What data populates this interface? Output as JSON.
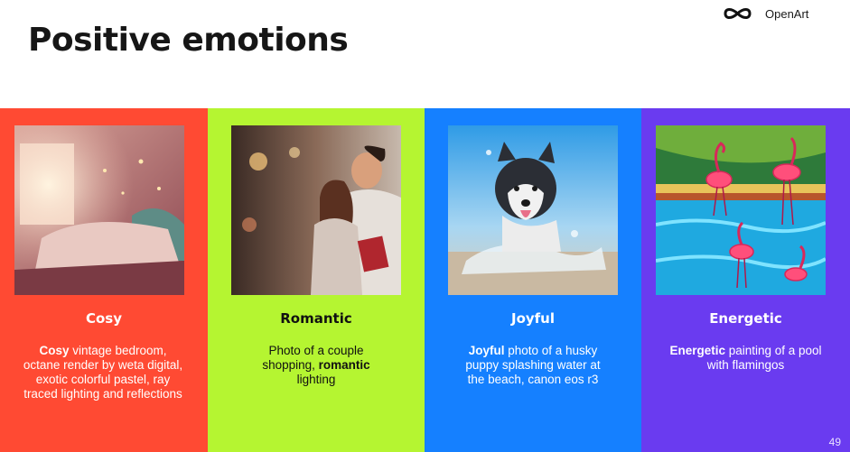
{
  "page_title": "Positive emotions",
  "brand": {
    "name": "OpenArt",
    "logo_icon": "infinity-loop-icon"
  },
  "panels": [
    {
      "title": "Cosy",
      "bg_color": "#ff4a33",
      "text_color": "#ffffff",
      "image": "cosy-bedroom-image",
      "desc_bold": "Cosy",
      "desc_after": " vintage bedroom, octane render by weta digital, exotic colorful pastel, ray traced lighting and reflections"
    },
    {
      "title": "Romantic",
      "bg_color": "#b5f531",
      "text_color": "#111111",
      "image": "couple-shopping-image",
      "desc_before": "Photo of a couple shopping, ",
      "desc_bold": "romantic",
      "desc_after": " lighting"
    },
    {
      "title": "Joyful",
      "bg_color": "#1580ff",
      "text_color": "#ffffff",
      "image": "husky-puppy-beach-image",
      "desc_bold": "Joyful",
      "desc_after": " photo of a husky puppy splashing water at the beach, canon eos r3"
    },
    {
      "title": "Energetic",
      "bg_color": "#6a3bf0",
      "text_color": "#ffffff",
      "image": "flamingo-pool-painting-image",
      "desc_bold": "Energetic",
      "desc_after": " painting of a pool with flamingos"
    }
  ],
  "page_number": "49"
}
